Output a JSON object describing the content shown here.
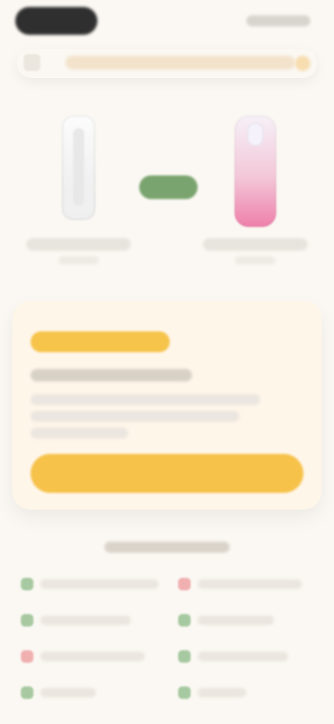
{
  "status_bar": {
    "left_pill": "",
    "right_indicators": ""
  },
  "top_bar": {
    "search_placeholder": "",
    "back_icon": "back-icon",
    "right_icon": "heart-icon"
  },
  "comparison": {
    "left_product": {
      "name": "",
      "subtitle": ""
    },
    "right_product": {
      "name": "",
      "subtitle": ""
    },
    "vs_label": ""
  },
  "promo": {
    "badge": "",
    "title": "",
    "description_lines": [
      "",
      "",
      ""
    ],
    "cta_label": ""
  },
  "features": {
    "section_title": "",
    "items_left": [
      {
        "status": "good",
        "label": ""
      },
      {
        "status": "good",
        "label": ""
      },
      {
        "status": "bad",
        "label": ""
      },
      {
        "status": "good",
        "label": ""
      }
    ],
    "items_right": [
      {
        "status": "bad",
        "label": ""
      },
      {
        "status": "good",
        "label": ""
      },
      {
        "status": "good",
        "label": ""
      },
      {
        "status": "good",
        "label": ""
      }
    ]
  },
  "colors": {
    "background": "#fbf8f3",
    "accent_yellow": "#f6c24a",
    "accent_green": "#7aa46f",
    "accent_pink": "#ee7fa9",
    "status_good": "#a7c9a1",
    "status_bad": "#f0b0b0"
  }
}
